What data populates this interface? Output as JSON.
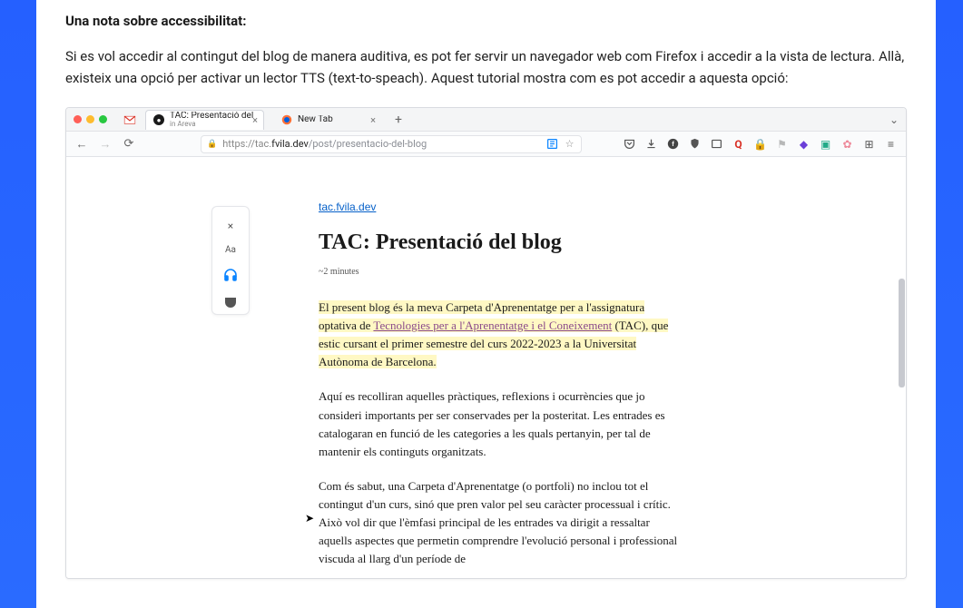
{
  "note": {
    "heading": "Una nota sobre accessibilitat:",
    "body": "Si es vol accedir al contingut del blog de manera auditiva, es pot fer servir un navegador web com Firefox i accedir a la vista de lectura. Allà, existeix una opció per activar un lector TTS (text-to-speach). Aquest tutorial mostra com es pot accedir a aquesta opció:"
  },
  "browser": {
    "tabs": [
      {
        "title": "TAC: Presentació del blog",
        "subtitle": "in Areva",
        "favicon": "dark-circle"
      },
      {
        "title": "New Tab",
        "favicon": "firefox"
      }
    ],
    "url": {
      "scheme": "https://",
      "sub": "tac.",
      "host": "fvila.dev",
      "path": "/post/presentacio-del-blog"
    },
    "toolbar_icons": [
      "reader",
      "star",
      "pocket",
      "download",
      "fb",
      "shield",
      "container",
      "search",
      "lock",
      "flag",
      "diamond",
      "window",
      "gear",
      "ext",
      "menu"
    ]
  },
  "reader_rail": {
    "close": "×",
    "aa": "Aa",
    "headphones": "headphones-icon",
    "pocket": "pocket-icon"
  },
  "article": {
    "site_link": "tac.fvila.dev",
    "title": "TAC: Presentació del blog",
    "meta": "~2 minutes",
    "p1_pre": "El present blog és la meva Carpeta d'Aprenentatge per a l'assignatura optativa de ",
    "p1_link": "Tecnologies per a l'Aprenentatge i el Coneixement",
    "p1_post": " (TAC), que estic cursant el primer semestre del curs 2022-2023 a la Universitat Autònoma de Barcelona.",
    "p2": "Aquí es recolliran aquelles pràctiques, reflexions i ocurrències que jo consideri importants per ser conservades per la posteritat. Les entrades es catalogaran en funció de les categories a les quals pertanyin, per tal de mantenir els continguts organitzats.",
    "p3": "Com és sabut, una Carpeta d'Aprenentatge (o portfoli) no inclou tot el contingut d'un curs, sinó que pren valor pel seu caràcter processual i crític. Això vol dir que l'èmfasi principal de les entrades va dirigit a ressaltar aquells aspectes que permetin comprendre l'evolució personal i professional viscuda al llarg d'un període de"
  }
}
